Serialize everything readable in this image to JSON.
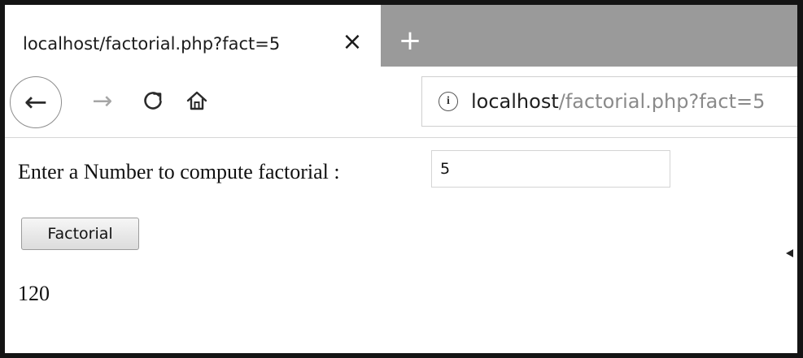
{
  "tab": {
    "title": "localhost/factorial.php?fact=5",
    "close_icon": "×",
    "new_tab_icon": "+"
  },
  "nav": {
    "back_icon": "←",
    "forward_icon": "→",
    "reload_icon": "reload-icon",
    "home_icon": "home-icon"
  },
  "urlbar": {
    "info_icon": "i",
    "host": "localhost",
    "path": "/factorial.php?fact=5"
  },
  "form": {
    "prompt": "Enter a Number to compute factorial :",
    "input_value": "5",
    "button_label": "Factorial"
  },
  "result": {
    "value": "120"
  },
  "colors": {
    "tab_strip": "#9a9a9a",
    "border": "#141414",
    "url_path": "#8a8a8a"
  }
}
